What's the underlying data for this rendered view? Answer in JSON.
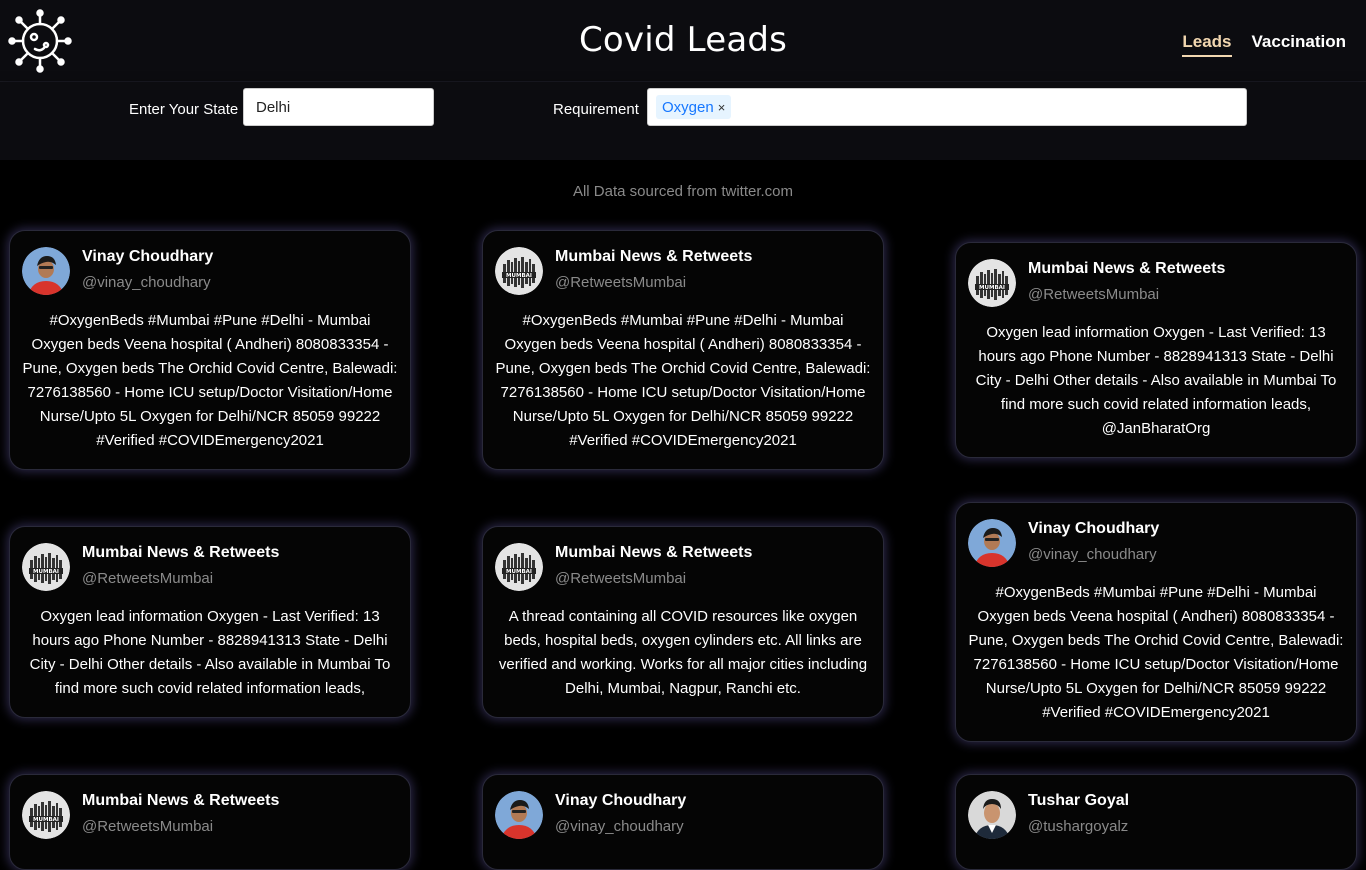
{
  "header": {
    "title": "Covid Leads",
    "nav": [
      {
        "label": "Leads",
        "active": true
      },
      {
        "label": "Vaccination",
        "active": false
      }
    ]
  },
  "filters": {
    "state_label": "Enter Your State",
    "state_value": "Delhi",
    "requirement_label": "Requirement",
    "requirement_tags": [
      "Oxygen"
    ],
    "tag_close": "×"
  },
  "source_note": "All Data sourced from twitter.com",
  "colors": {
    "accent": "#f2d7b0",
    "tag_text": "#1677ff",
    "card_glow": "#786ec8"
  },
  "cards": [
    {
      "name": "Vinay Choudhary",
      "handle": "@vinay_choudhary",
      "avatar": "person-red-shirt",
      "text": "#OxygenBeds #Mumbai #Pune #Delhi - Mumbai Oxygen beds Veena hospital ( Andheri) 8080833354 - Pune, Oxygen beds The Orchid Covid Centre, Balewadi: 7276138560 - Home ICU setup/Doctor Visitation/Home Nurse/Upto 5L Oxygen for Delhi/NCR 85059 99222 #Verified #COVIDEmergency2021"
    },
    {
      "name": "Mumbai News & Retweets",
      "handle": "@RetweetsMumbai",
      "avatar": "mumbai-logo",
      "text": "#OxygenBeds #Mumbai #Pune #Delhi - Mumbai Oxygen beds Veena hospital ( Andheri) 8080833354 - Pune, Oxygen beds The Orchid Covid Centre, Balewadi: 7276138560 - Home ICU setup/Doctor Visitation/Home Nurse/Upto 5L Oxygen for Delhi/NCR 85059 99222 #Verified #COVIDEmergency2021"
    },
    {
      "name": "Mumbai News & Retweets",
      "handle": "@RetweetsMumbai",
      "avatar": "mumbai-logo",
      "text": "Oxygen lead information Oxygen - Last Verified: 13 hours ago Phone Number - 8828941313 State - Delhi City - Delhi Other details - Also available in Mumbai To find more such covid related information leads, @JanBharatOrg"
    },
    {
      "name": "Mumbai News & Retweets",
      "handle": "@RetweetsMumbai",
      "avatar": "mumbai-logo",
      "text": "Oxygen lead information Oxygen - Last Verified: 13 hours ago Phone Number - 8828941313 State - Delhi City - Delhi Other details - Also available in Mumbai To find more such covid related information leads,"
    },
    {
      "name": "Mumbai News & Retweets",
      "handle": "@RetweetsMumbai",
      "avatar": "mumbai-logo",
      "text": "A thread containing all COVID resources like oxygen beds, hospital beds, oxygen cylinders etc. All links are verified and working. Works for all major cities including Delhi, Mumbai, Nagpur, Ranchi etc."
    },
    {
      "name": "Vinay Choudhary",
      "handle": "@vinay_choudhary",
      "avatar": "person-red-shirt",
      "text": "#OxygenBeds #Mumbai #Pune #Delhi - Mumbai Oxygen beds Veena hospital ( Andheri) 8080833354 - Pune, Oxygen beds The Orchid Covid Centre, Balewadi: 7276138560 - Home ICU setup/Doctor Visitation/Home Nurse/Upto 5L Oxygen for Delhi/NCR 85059 99222 #Verified #COVIDEmergency2021"
    },
    {
      "name": "Mumbai News & Retweets",
      "handle": "@RetweetsMumbai",
      "avatar": "mumbai-logo",
      "text": ""
    },
    {
      "name": "Vinay Choudhary",
      "handle": "@vinay_choudhary",
      "avatar": "person-red-shirt",
      "text": ""
    },
    {
      "name": "Tushar Goyal",
      "handle": "@tushargoyalz",
      "avatar": "person-suit",
      "text": ""
    }
  ]
}
